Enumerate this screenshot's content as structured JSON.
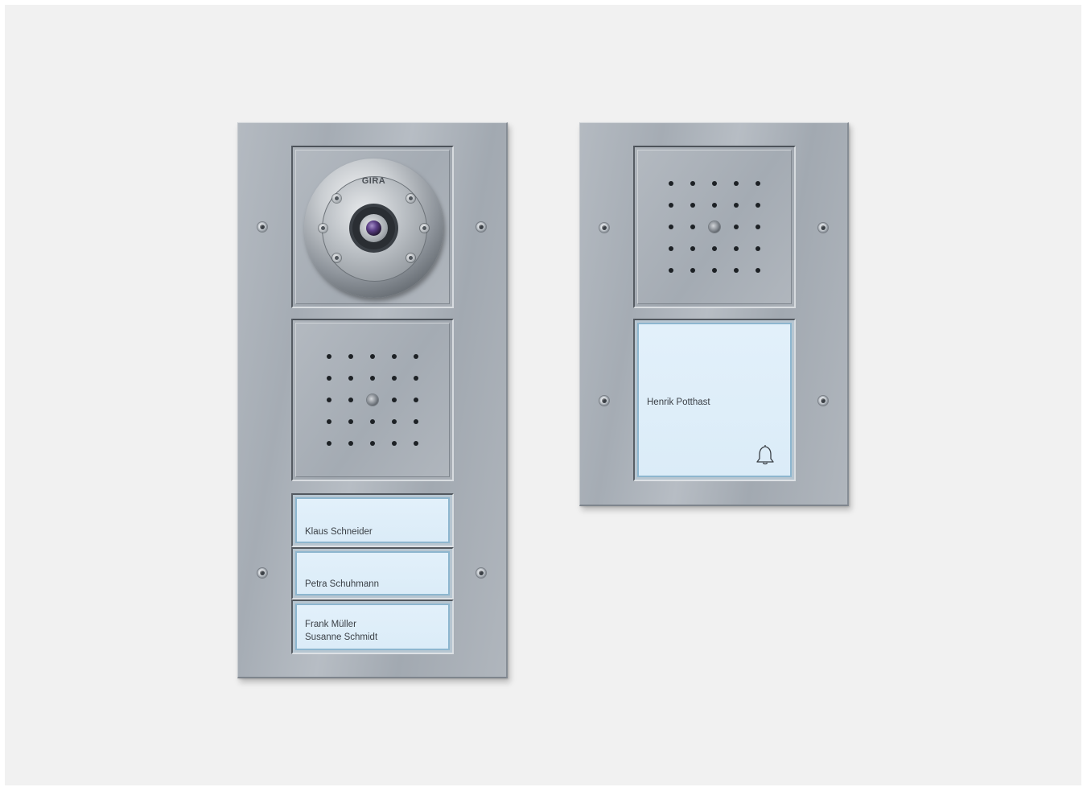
{
  "scene": {
    "background_color": "#f1f1f1",
    "plate_color": "#adb3ba",
    "label_color": "#dbecf8"
  },
  "left_panel": {
    "camera": {
      "brand": "GIRA"
    },
    "name_buttons": [
      {
        "line1": "Klaus Schneider",
        "line2": ""
      },
      {
        "line1": "Petra Schuhmann",
        "line2": ""
      },
      {
        "line1": "Frank Müller",
        "line2": "Susanne Schmidt"
      }
    ]
  },
  "right_panel": {
    "name_button": {
      "label": "Henrik Potthast",
      "icon": "bell-icon"
    }
  }
}
